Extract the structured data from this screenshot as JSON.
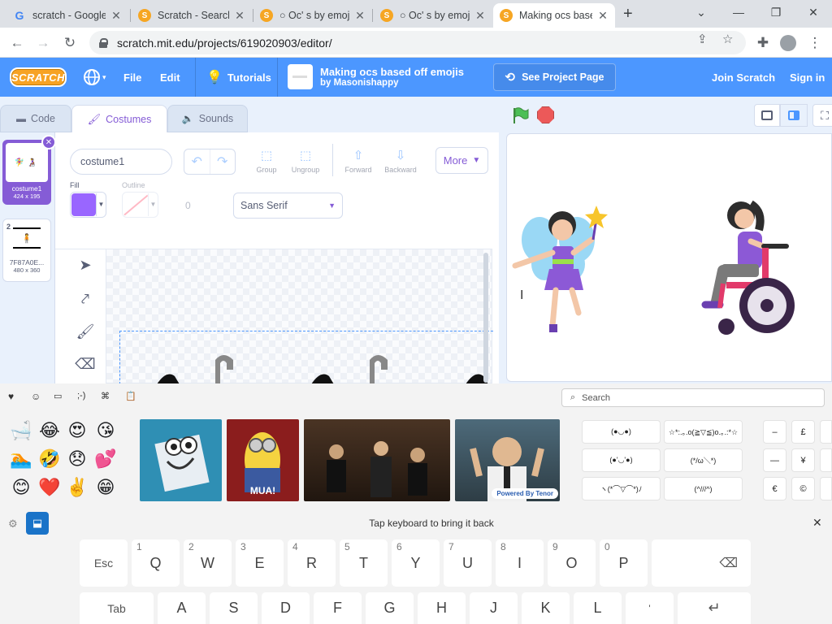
{
  "browser": {
    "tabs": [
      {
        "title": "scratch - Google Search",
        "favicon": "google-icon",
        "active": false
      },
      {
        "title": "Scratch - Search",
        "favicon": "scratch-cat-icon",
        "active": false
      },
      {
        "title": "○ Oc' s by emojis",
        "favicon": "scratch-cat-icon",
        "active": false
      },
      {
        "title": "○ Oc' s by emojis",
        "favicon": "scratch-cat-icon",
        "active": false
      },
      {
        "title": "Making ocs based off emojis",
        "favicon": "scratch-cat-icon",
        "active": true
      }
    ],
    "url": "scratch.mit.edu/projects/619020903/editor/"
  },
  "menubar": {
    "logo": "SCRATCH",
    "file": "File",
    "edit": "Edit",
    "tutorials": "Tutorials",
    "project_title": "Making ocs based off emojis",
    "author": "by Masonishappy",
    "see_project_page": "See Project Page",
    "join": "Join Scratch",
    "signin": "Sign in",
    "accent": "#4c97ff"
  },
  "editor_tabs": {
    "code": "Code",
    "costumes": "Costumes",
    "sounds": "Sounds"
  },
  "costumes": [
    {
      "num": "1",
      "name": "costume1",
      "size": "424 x 195",
      "selected": true
    },
    {
      "num": "2",
      "name": "7F87A0E...",
      "size": "480 x 360",
      "selected": false
    }
  ],
  "paint": {
    "costume_name": "costume1",
    "group": "Group",
    "ungroup": "Ungroup",
    "forward": "Forward",
    "backward": "Backward",
    "more": "More",
    "fill_label": "Fill",
    "outline_label": "Outline",
    "fill_color": "#9966ff",
    "outline_width": "0",
    "font": "Sans Serif"
  },
  "keyboard": {
    "search_placeholder": "Search",
    "hint": "Tap keyboard to bring it back",
    "emojis": [
      "🛁",
      "😂",
      "😍",
      "😘",
      "🏊",
      "🤣",
      "😞",
      "💕",
      "😊",
      "❤️",
      "✌️",
      "😁"
    ],
    "gifs": [
      {
        "label": ""
      },
      {
        "label": "MUA!"
      },
      {
        "label": ""
      },
      {
        "label": "Powered By Tenor"
      }
    ],
    "kaomoji": [
      "(●◡●)",
      "☆*:.｡.o(≧▽≦)o.｡.:*☆",
      "(●'◡'●)",
      "(*/ω＼*)",
      "ヽ(*⌒▽⌒*)ﾉ",
      "(^///^)"
    ],
    "symbols": [
      "–",
      "£",
      "—",
      "¥",
      "€",
      "©"
    ],
    "row1": [
      {
        "k": "Esc",
        "n": ""
      },
      {
        "k": "Q",
        "n": "1"
      },
      {
        "k": "W",
        "n": "2"
      },
      {
        "k": "E",
        "n": "3"
      },
      {
        "k": "R",
        "n": "4"
      },
      {
        "k": "T",
        "n": "5"
      },
      {
        "k": "Y",
        "n": "6"
      },
      {
        "k": "U",
        "n": "7"
      },
      {
        "k": "I",
        "n": "8"
      },
      {
        "k": "O",
        "n": "9"
      },
      {
        "k": "P",
        "n": "0"
      }
    ],
    "row2": [
      "Tab",
      "A",
      "S",
      "D",
      "F",
      "G",
      "H",
      "J",
      "K",
      "L"
    ]
  }
}
